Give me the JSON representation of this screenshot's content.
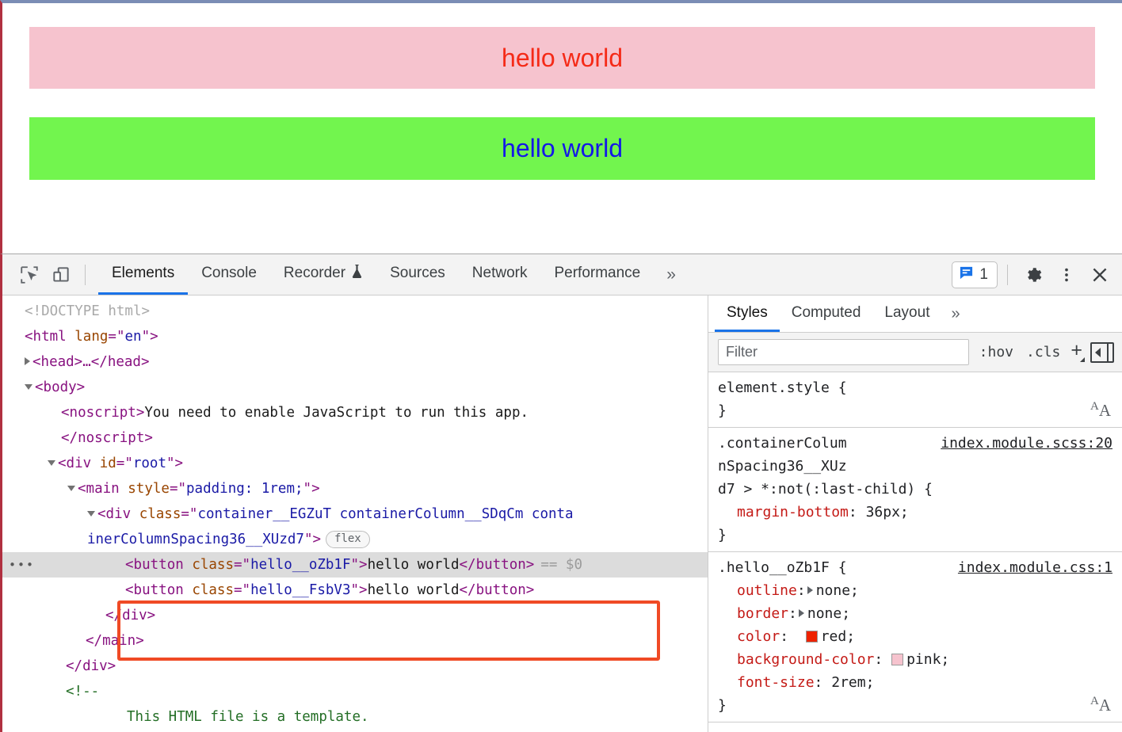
{
  "page_preview": {
    "buttons": [
      {
        "label": "hello world",
        "class": "hello__oZb1F",
        "bg": "#f6c3ce",
        "color": "#f52a17"
      },
      {
        "label": "hello world",
        "class": "hello__FsbV3",
        "bg": "#72f54e",
        "color": "#1318e8"
      }
    ]
  },
  "devtools": {
    "toolbar": {
      "icons": [
        {
          "name": "inspect-element-icon"
        },
        {
          "name": "device-toolbar-icon"
        }
      ],
      "tabs": [
        {
          "label": "Elements",
          "active": true
        },
        {
          "label": "Console",
          "active": false
        },
        {
          "label": "Recorder",
          "active": false,
          "icon": "flask-icon"
        },
        {
          "label": "Sources",
          "active": false
        },
        {
          "label": "Network",
          "active": false
        },
        {
          "label": "Performance",
          "active": false
        }
      ],
      "more_tabs": "»",
      "issues_count": "1",
      "settings_icon": "gear-icon",
      "menu_icon": "kebab-menu-icon",
      "close_icon": "close-icon"
    },
    "dom_tree": {
      "lines": [
        {
          "id": "doctype",
          "text": "<!DOCTYPE html>"
        },
        {
          "id": "html_open",
          "tag": "html",
          "attr": "lang",
          "value": "en"
        },
        {
          "id": "head",
          "text": "<head>…</head>"
        },
        {
          "id": "body_open",
          "text": "<body>"
        },
        {
          "id": "noscript",
          "text": "<noscript>You need to enable JavaScript to run this app."
        },
        {
          "id": "noscript_close",
          "text": "</noscript>"
        },
        {
          "id": "root_div",
          "tag": "div",
          "attr": "id",
          "value": "root"
        },
        {
          "id": "main",
          "tag": "main",
          "attr": "style",
          "value": "padding: 1rem;"
        },
        {
          "id": "container_div_1",
          "tag": "div",
          "attr": "class",
          "value": "container__EGZuT containerColumn__SDqCm conta"
        },
        {
          "id": "container_div_2",
          "value_cont": "inerColumnSpacing36__XUzd7",
          "badge": "flex"
        },
        {
          "id": "button_1",
          "tag": "button",
          "attr": "class",
          "value": "hello__oZb1F",
          "text": "hello world",
          "marker": "== $0",
          "selected": true
        },
        {
          "id": "button_2",
          "tag": "button",
          "attr": "class",
          "value": "hello__FsbV3",
          "text": "hello world"
        },
        {
          "id": "div_close",
          "text": "</div>"
        },
        {
          "id": "main_close",
          "text": "</main>"
        },
        {
          "id": "root_close",
          "text": "</div>"
        },
        {
          "id": "comment_open",
          "text": "<!--"
        },
        {
          "id": "comment_body",
          "text": "This HTML file is a template."
        }
      ],
      "ellipsis": "…"
    },
    "styles_panel": {
      "tabs": [
        {
          "label": "Styles",
          "active": true
        },
        {
          "label": "Computed",
          "active": false
        },
        {
          "label": "Layout",
          "active": false
        }
      ],
      "more_tabs": "»",
      "filter_placeholder": "Filter",
      "filter_value": "",
      "hov_label": ":hov",
      "cls_label": ".cls",
      "plus_label": "+",
      "rules": [
        {
          "selector": "element.style {",
          "source": "",
          "declarations": [],
          "close": "}"
        },
        {
          "selector": ".containerColumnSpacing36__XUzd7 > *:not(:last-child) {",
          "selector_line1": ".containerColum",
          "selector_line2": "nSpacing36__XUz",
          "selector_line3": "d7 > *:not(:last-child) {",
          "source": "index.module.scss:20",
          "declarations": [
            {
              "prop": "margin-bottom",
              "value": "36px;"
            }
          ],
          "close": "}"
        },
        {
          "selector": ".hello__oZb1F {",
          "source": "index.module.css:1",
          "declarations": [
            {
              "prop": "outline",
              "value": "none;",
              "expandable": true
            },
            {
              "prop": "border",
              "value": "none;",
              "expandable": true
            },
            {
              "prop": "color",
              "value": "red;",
              "swatch": "#ee2200"
            },
            {
              "prop": "background-color",
              "value": "pink;",
              "swatch": "#f6c3ce"
            },
            {
              "prop": "font-size",
              "value": "2rem;"
            }
          ],
          "close": "}"
        }
      ]
    }
  }
}
